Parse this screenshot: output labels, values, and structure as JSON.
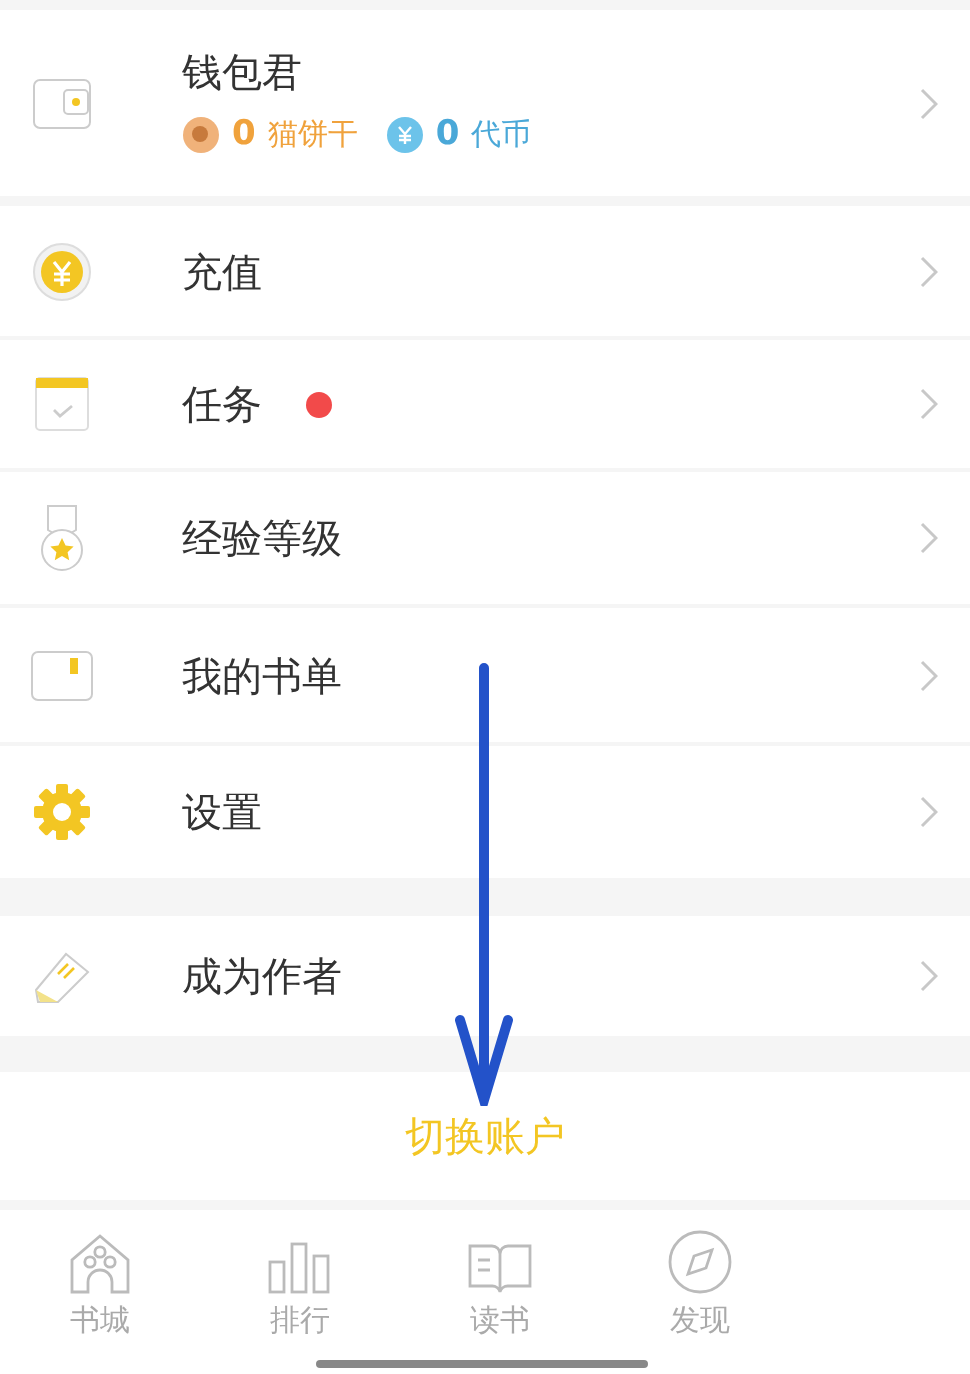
{
  "wallet": {
    "title": "钱包君",
    "biscuits": {
      "count": "0",
      "label": "猫饼干"
    },
    "coins": {
      "count": "0",
      "label": "代币"
    }
  },
  "menu_groups": [
    [
      {
        "label": "充值",
        "badge": false
      },
      {
        "label": "任务",
        "badge": true
      },
      {
        "label": "经验等级",
        "badge": false
      },
      {
        "label": "我的书单",
        "badge": false
      },
      {
        "label": "设置",
        "badge": false
      }
    ],
    [
      {
        "label": "成为作者",
        "badge": false
      }
    ]
  ],
  "switch_account": "切换账户",
  "tab_bar": [
    {
      "label": "书城",
      "selected": false
    },
    {
      "label": "排行",
      "selected": false
    },
    {
      "label": "读书",
      "selected": false
    },
    {
      "label": "发现",
      "selected": false
    }
  ]
}
